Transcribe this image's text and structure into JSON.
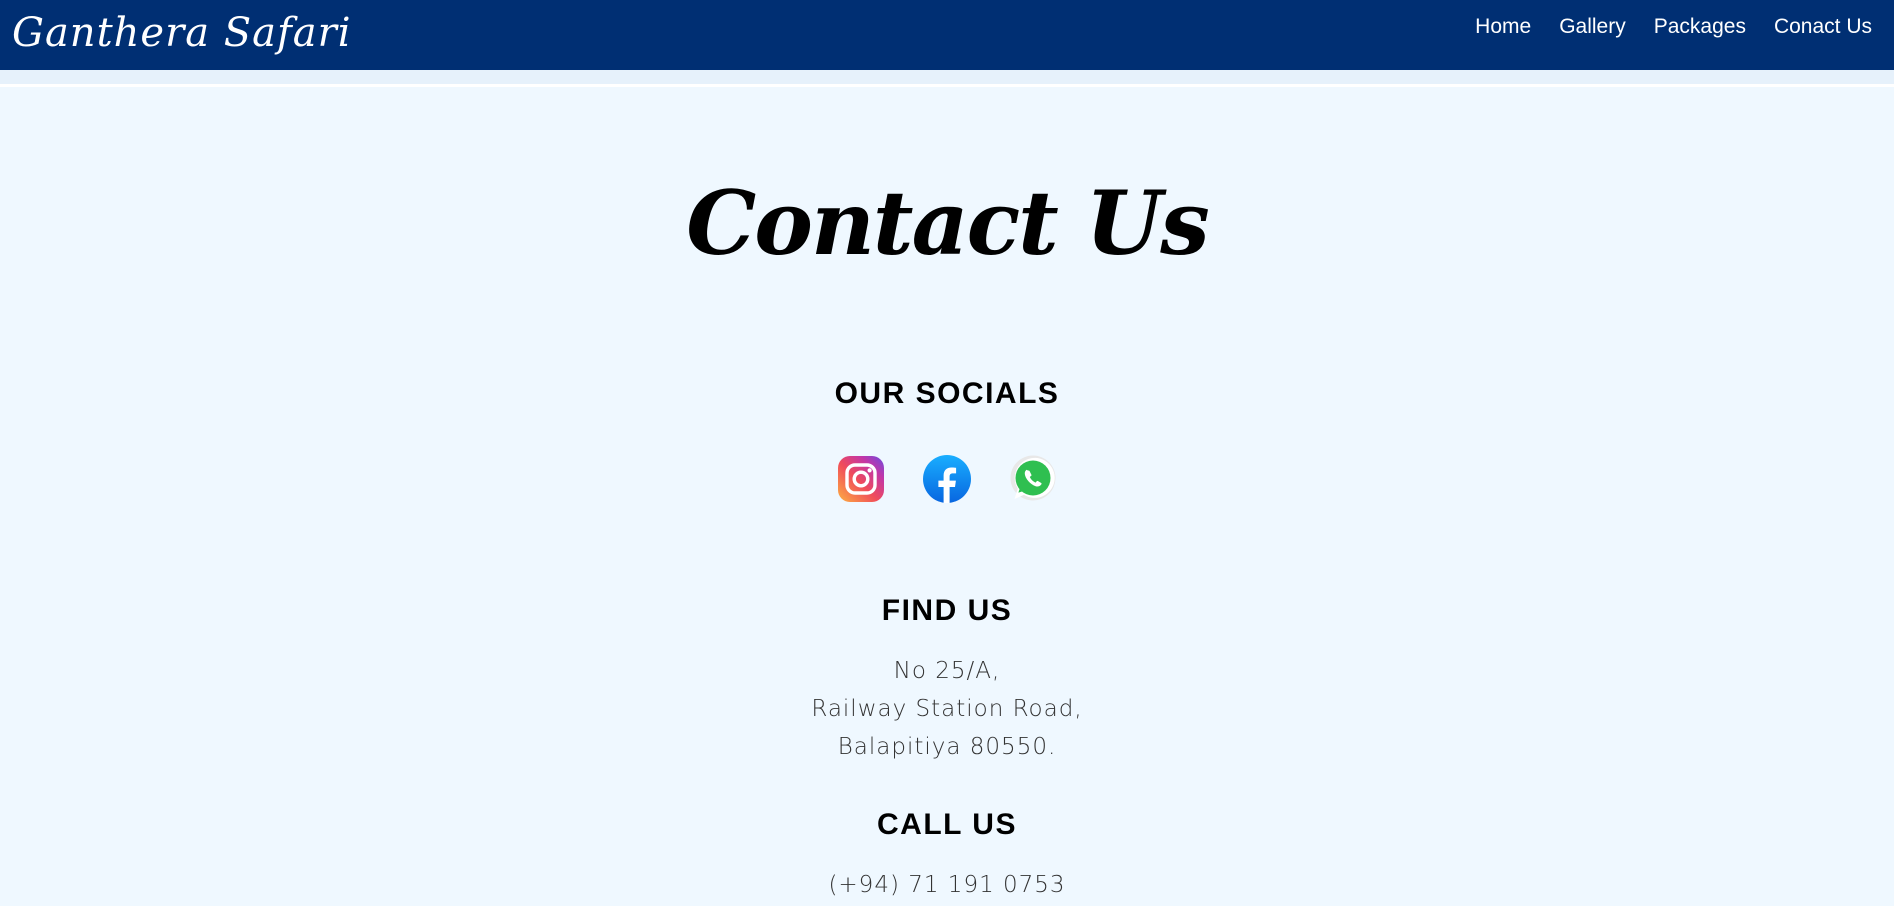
{
  "navbar": {
    "brand": "Ganthera Safari",
    "links": [
      "Home",
      "Gallery",
      "Packages",
      "Conact Us"
    ],
    "background": "#002f73"
  },
  "page": {
    "title": "Contact Us",
    "background": "#eff8ff"
  },
  "socials": {
    "heading": "OUR SOCIALS",
    "icons": [
      "instagram-icon",
      "facebook-icon",
      "whatsapp-icon"
    ]
  },
  "find_us": {
    "heading": "FIND US",
    "address_lines": [
      "No 25/A,",
      "Railway Station Road,",
      "Balapitiya 80550."
    ]
  },
  "call_us": {
    "heading": "CALL US",
    "phone": "(+94) 71 191 0753"
  }
}
